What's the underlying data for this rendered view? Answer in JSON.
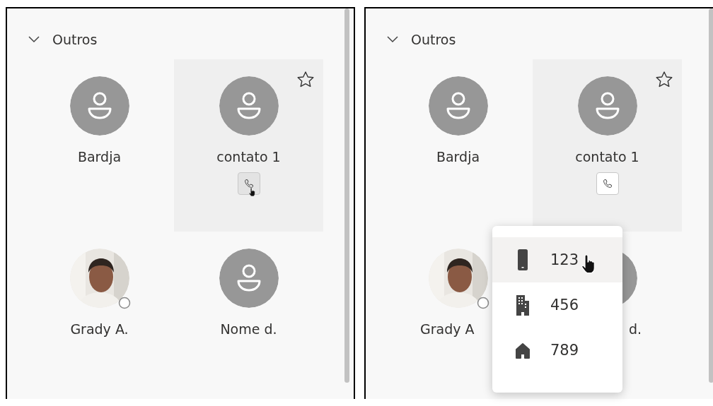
{
  "panels": [
    {
      "section": {
        "title": "Outros",
        "expanded": true
      },
      "contacts": [
        {
          "name": "Bardja",
          "kind": "placeholder",
          "hovered": false,
          "pointer": false
        },
        {
          "name": "contato 1",
          "kind": "placeholder",
          "hovered": true,
          "call_pressed": true,
          "pointer": true
        },
        {
          "name": "Grady A.",
          "hovered": false,
          "pointer": false
        },
        {
          "name": "Nome d.",
          "kind": "placeholder",
          "hovered": false,
          "pointer": false
        }
      ]
    },
    {
      "section": {
        "title": "Outros",
        "expanded": true
      },
      "contacts": [
        {
          "name": "Bardja",
          "kind": "placeholder",
          "hovered": false,
          "pointer": false
        },
        {
          "name": "contato 1",
          "kind": "placeholder",
          "hovered": true,
          "call_pressed": false,
          "pointer": false
        },
        {
          "name": "Grady A",
          "hovered": false,
          "pointer": false
        },
        {
          "name": "d.",
          "kind": "placeholder",
          "hovered": false,
          "pointer": false
        }
      ],
      "phone_menu": {
        "items": [
          {
            "kind": "mobile",
            "number": "123",
            "hovered": true,
            "pointer": true
          },
          {
            "kind": "work",
            "number": "456",
            "hovered": false,
            "pointer": false
          },
          {
            "kind": "home",
            "number": "789",
            "hovered": false,
            "pointer": false
          }
        ]
      }
    }
  ]
}
